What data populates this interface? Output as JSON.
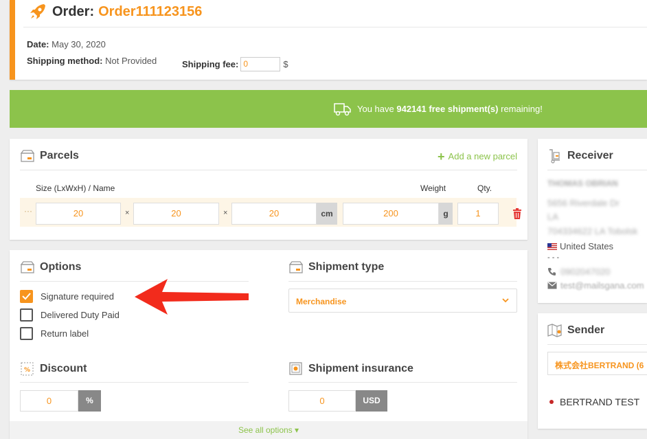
{
  "order": {
    "title_label": "Order:",
    "number": "Order111123156",
    "date_label": "Date:",
    "date_value": "May 30, 2020",
    "shipping_method_label": "Shipping method:",
    "shipping_method_value": "Not Provided",
    "shipping_fee_label": "Shipping fee:",
    "shipping_fee_value": "0",
    "currency_symbol": "$"
  },
  "banner": {
    "prefix": "You have ",
    "count": "942141",
    "middle": " free shipment(s)",
    "suffix": " remaining!"
  },
  "parcels": {
    "title": "Parcels",
    "add_label": "Add a new parcel",
    "col_size": "Size (LxWxH) / Name",
    "col_weight": "Weight",
    "col_qty": "Qty.",
    "row": {
      "drag": "···",
      "length": "20",
      "width": "20",
      "height": "20",
      "times": "×",
      "dim_unit": "cm",
      "weight": "200",
      "weight_unit": "g",
      "qty": "1"
    }
  },
  "options": {
    "title": "Options",
    "items": [
      {
        "label": "Signature required",
        "checked": true
      },
      {
        "label": "Delivered Duty Paid",
        "checked": false
      },
      {
        "label": "Return label",
        "checked": false
      }
    ],
    "shipment_type_title": "Shipment type",
    "shipment_type_value": "Merchandise",
    "discount_title": "Discount",
    "discount_value": "0",
    "discount_unit": "%",
    "insurance_title": "Shipment insurance",
    "insurance_value": "0",
    "insurance_unit": "USD",
    "see_all": "See all options ▾"
  },
  "receiver": {
    "title": "Receiver",
    "name": "THOMAS OBRIAN",
    "address1": "5656 Riverdale Dr",
    "address2": "LA",
    "address3": "704334622 LA Tobolsk",
    "country": "United States",
    "separator": "- - -",
    "phone": "0902047020",
    "email": "test@mailsgana.com"
  },
  "sender": {
    "title": "Sender",
    "company": "株式会社BERTRAND (6",
    "name": "BERTRAND TEST"
  },
  "colors": {
    "accent": "#f7941d",
    "green": "#8cc34b",
    "danger": "#e53935"
  }
}
